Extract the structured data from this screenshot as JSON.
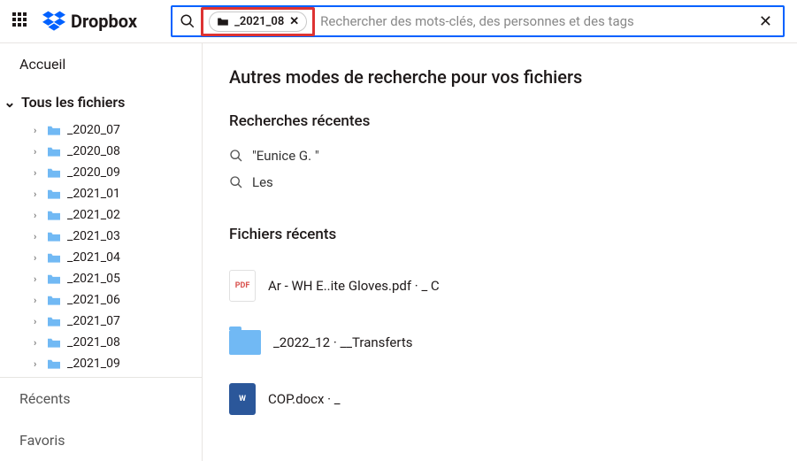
{
  "brand": "Dropbox",
  "search": {
    "chip": "_2021_08",
    "placeholder": "Rechercher des mots-clés, des personnes et des tags"
  },
  "sidebar": {
    "home": "Accueil",
    "allFiles": "Tous les fichiers",
    "folders": [
      "_2020_07",
      "_2020_08",
      "_2020_09",
      "_2021_01",
      "_2021_02",
      "_2021_03",
      "_2021_04",
      "_2021_05",
      "_2021_06",
      "_2021_07",
      "_2021_08",
      "_2021_09"
    ],
    "recent": "Récents",
    "favorites": "Favoris"
  },
  "main": {
    "otherWays": "Autres modes de recherche pour vos fichiers",
    "recentSearches": "Recherches récentes",
    "queries": [
      "\"Eunice G.      \"",
      "Les                                                    "
    ],
    "recentFiles": "Fichiers récents",
    "files": [
      {
        "kind": "pdf",
        "name": "Ar                                         - WH     E..ite Gloves.pdf · _                  C"
      },
      {
        "kind": "folder",
        "name": "_2022_12 · __Transferts"
      },
      {
        "kind": "word",
        "name": "COP.docx · _  "
      }
    ]
  }
}
